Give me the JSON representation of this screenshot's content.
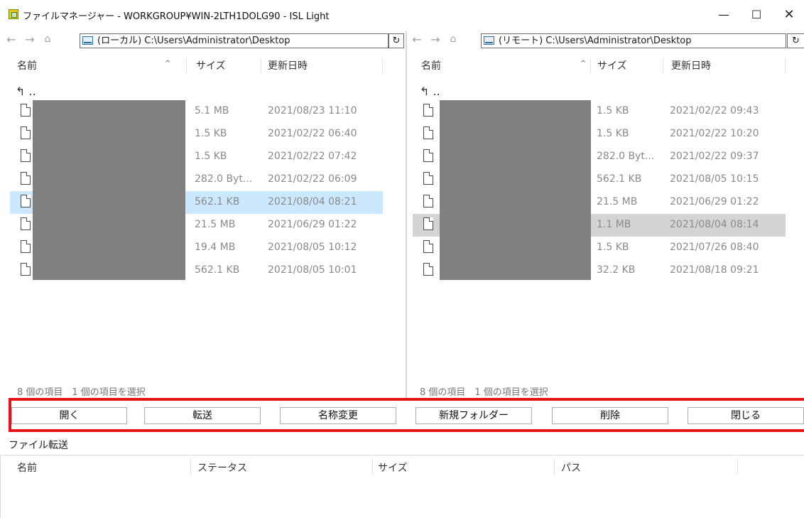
{
  "window": {
    "title": "ファイルマネージャー - WORKGROUP¥WIN-2LTH1DOLG90 - ISL Light",
    "minimize": "—",
    "maximize": "☐",
    "close": "✕"
  },
  "nav": {
    "back": "←",
    "forward": "→",
    "home": "⌂",
    "refresh": "↻"
  },
  "left_pane": {
    "path": "(ローカル) C:\\Users\\Administrator\\Desktop",
    "columns": {
      "name": "名前",
      "size": "サイズ",
      "modified": "更新日時"
    },
    "updir": "↰ ..",
    "rows": [
      {
        "size": "5.1 MB",
        "date": "2021/08/23 11:10"
      },
      {
        "size": "1.5 KB",
        "date": "2021/02/22 06:40"
      },
      {
        "size": "1.5 KB",
        "date": "2021/02/22 07:42"
      },
      {
        "size": "282.0 Byt...",
        "date": "2021/02/22 06:09"
      },
      {
        "size": "562.1 KB",
        "date": "2021/08/04 08:21"
      },
      {
        "size": "21.5 MB",
        "date": "2021/06/29 01:22"
      },
      {
        "size": "19.4 MB",
        "date": "2021/08/05 10:12"
      },
      {
        "size": "562.1 KB",
        "date": "2021/08/05 10:01"
      }
    ],
    "selected_index": 4,
    "status": "8 個の項目　1 個の項目を選択"
  },
  "right_pane": {
    "path": "(リモート) C:\\Users\\Administrator\\Desktop",
    "columns": {
      "name": "名前",
      "size": "サイズ",
      "modified": "更新日時"
    },
    "updir": "↰ ..",
    "rows": [
      {
        "size": "1.5 KB",
        "date": "2021/02/22 09:43"
      },
      {
        "size": "1.5 KB",
        "date": "2021/02/22 10:20"
      },
      {
        "size": "282.0 Byt...",
        "date": "2021/02/22 09:37"
      },
      {
        "size": "562.1 KB",
        "date": "2021/08/05 10:15"
      },
      {
        "size": "21.5 MB",
        "date": "2021/06/29 01:22"
      },
      {
        "size": "1.1 MB",
        "date": "2021/08/04 08:14"
      },
      {
        "size": "1.5 KB",
        "date": "2021/07/26 08:40"
      },
      {
        "size": "32.2 KB",
        "date": "2021/08/18 09:21"
      }
    ],
    "selected_index": 5,
    "status": "8 個の項目　1 個の項目を選択"
  },
  "buttons": {
    "open": "開く",
    "transfer": "転送",
    "rename": "名称変更",
    "new_folder": "新規フォルダー",
    "delete": "削除",
    "close": "閉じる"
  },
  "transfer": {
    "label": "ファイル転送",
    "columns": {
      "name": "名前",
      "status": "ステータス",
      "size": "サイズ",
      "path": "パス"
    }
  },
  "colors": {
    "highlight_border": "#e8141c",
    "selection_blue": "#cce8ff",
    "selection_gray": "#d4d4d4",
    "redaction": "#808080"
  }
}
